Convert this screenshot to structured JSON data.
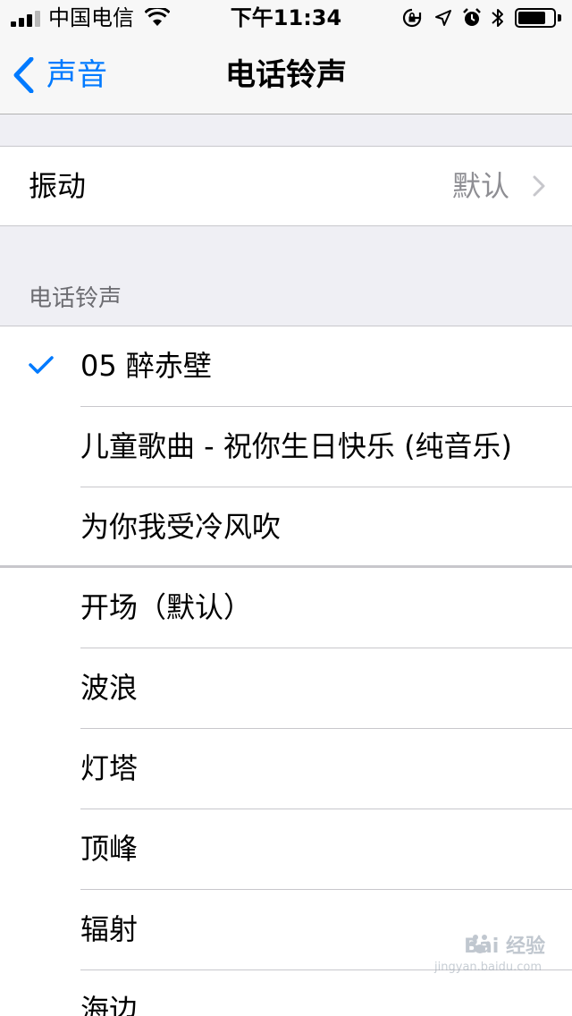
{
  "status_bar": {
    "carrier": "中国电信",
    "time": "下午11:34",
    "icons": [
      "signal-icon",
      "wifi-icon",
      "orientation-lock-icon",
      "location-icon",
      "alarm-icon",
      "bluetooth-icon",
      "battery-icon"
    ],
    "signal_bars_filled": 3,
    "signal_bars_total": 4,
    "battery_level": 0.8
  },
  "nav": {
    "back_label": "声音",
    "title": "电话铃声"
  },
  "vibration": {
    "label": "振动",
    "value": "默认"
  },
  "ringtones": {
    "section_header": "电话铃声",
    "custom": [
      {
        "label": "05 醉赤壁",
        "selected": true
      },
      {
        "label": "儿童歌曲 - 祝你生日快乐 (纯音乐)",
        "selected": false
      },
      {
        "label": "为你我受冷风吹",
        "selected": false
      }
    ],
    "builtin": [
      {
        "label": "开场（默认）"
      },
      {
        "label": "波浪"
      },
      {
        "label": "灯塔"
      },
      {
        "label": "顶峰"
      },
      {
        "label": "辐射"
      },
      {
        "label": "海边"
      }
    ]
  },
  "watermark": {
    "brand": "Bai 经验",
    "url": "jingyan.baidu.com"
  },
  "colors": {
    "accent": "#007aff",
    "background": "#efeff4",
    "separator": "#c8c7cc",
    "secondary_text": "#8e8e93"
  }
}
